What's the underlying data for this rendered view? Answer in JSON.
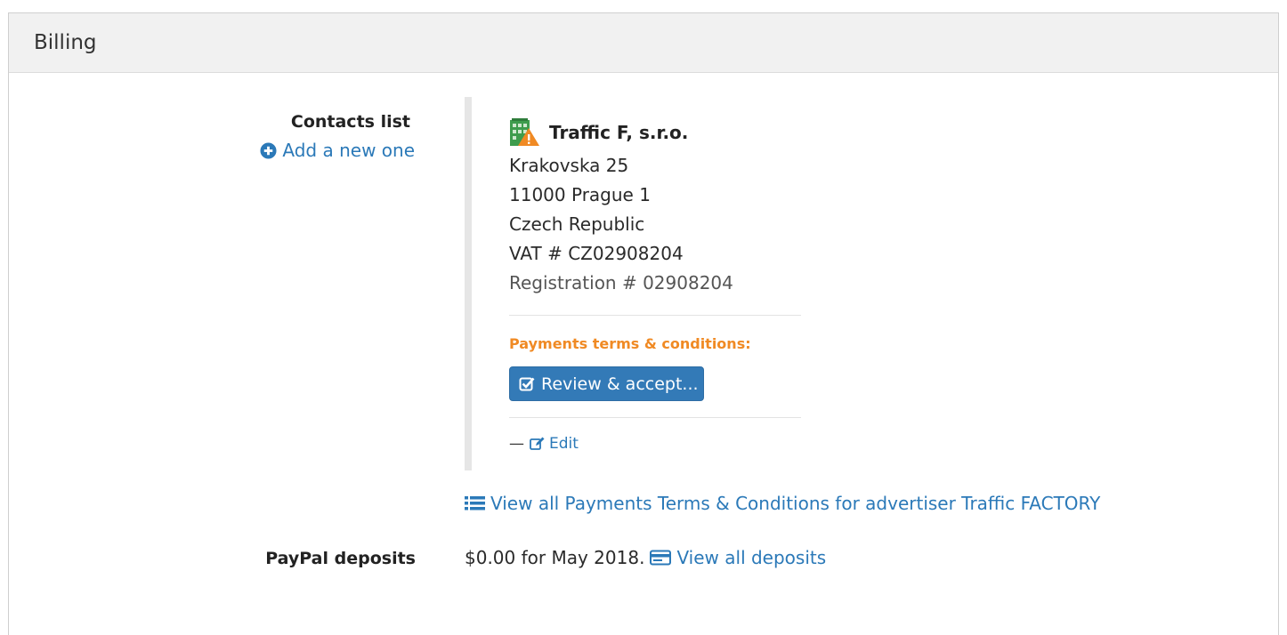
{
  "panel": {
    "title": "Billing"
  },
  "contacts": {
    "label": "Contacts list",
    "add_link": "Add a new one"
  },
  "contact": {
    "company": "Traffic F, s.r.o.",
    "street": "Krakovska 25",
    "city": "11000 Prague 1",
    "country": "Czech Republic",
    "vat": "VAT # CZ02908204",
    "registration": "Registration # 02908204",
    "terms_label": "Payments terms & conditions:",
    "review_button": "Review & accept...",
    "edit_prefix": "—",
    "edit_link": "Edit"
  },
  "view_all_terms": "View all Payments Terms & Conditions for advertiser Traffic FACTORY",
  "paypal": {
    "label": "PayPal deposits",
    "amount_text": "$0.00 for May 2018.",
    "view_link": "View all deposits"
  },
  "colors": {
    "link": "#2b79b8",
    "button": "#337ab7",
    "terms": "#f08a24"
  },
  "icons": [
    "plus-circle-icon",
    "building-icon",
    "check-square-icon",
    "edit-icon",
    "list-icon",
    "credit-card-icon"
  ]
}
